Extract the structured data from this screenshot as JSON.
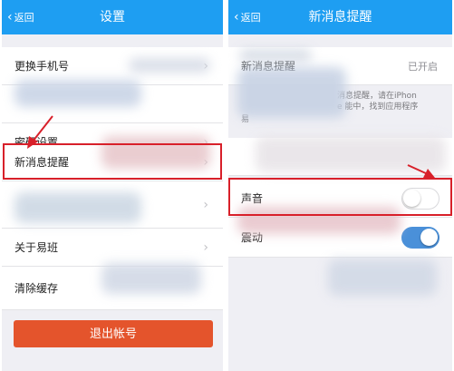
{
  "left": {
    "back_label": "返回",
    "title": "设置",
    "rows": [
      {
        "label": "更换手机号"
      },
      {
        "label": "密码设置"
      },
      {
        "label": "新消息提醒"
      },
      {
        "label": "关于易班"
      },
      {
        "label": "清除缓存"
      }
    ],
    "logout_label": "退出帐号"
  },
  "right": {
    "back_label": "返回",
    "title": "新消息提醒",
    "status_value": "已开启",
    "status_label": "新消息提醒",
    "description": {
      "line1": "消息提醒，请在iPhon",
      "line2": "e 能中，找到应用程序",
      "line3": "易"
    },
    "sound_label": "声音",
    "vibrate_label": "震动",
    "sound_on": false,
    "vibrate_on": true
  },
  "colors": {
    "navbar": "#1e9ef2",
    "logout": "#e4542c",
    "highlight": "#d8202a",
    "toggle_on": "#4a90d9"
  }
}
